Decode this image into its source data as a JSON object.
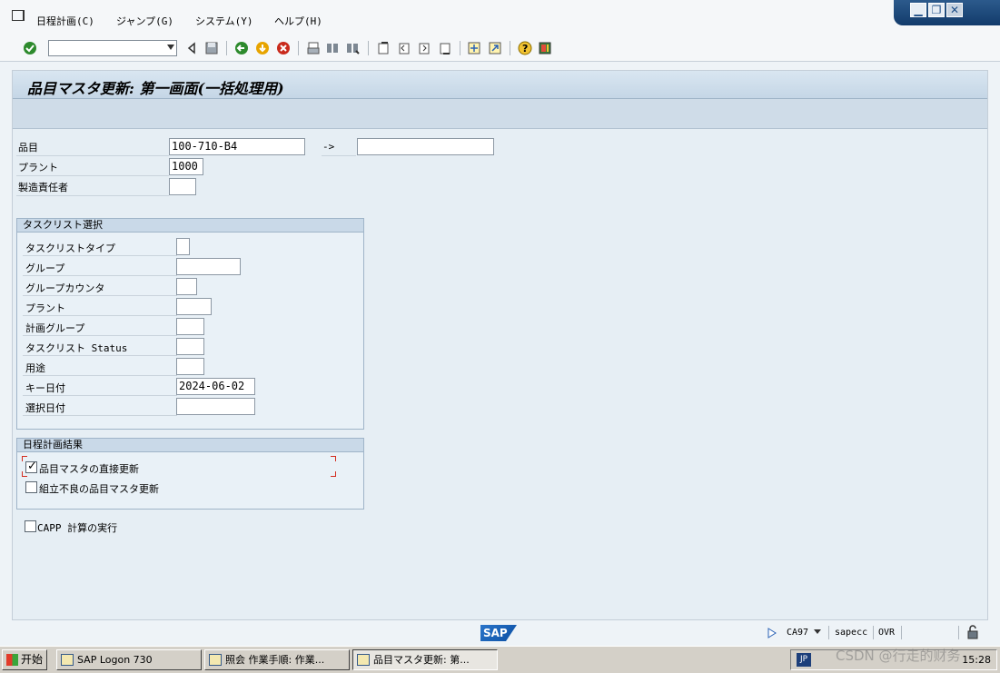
{
  "menubar": {
    "items": [
      "日程計画(C)",
      "ジャンプ(G)",
      "システム(Y)",
      "ヘルプ(H)"
    ]
  },
  "window_controls": {
    "minimize": "▁",
    "restore": "❐",
    "close": "✕"
  },
  "toolbar": {
    "command_field_value": "",
    "icons": [
      "enter-icon",
      "save-icon",
      "back-icon",
      "exit-icon",
      "cancel-icon",
      "print-icon",
      "find-icon",
      "find-next-icon",
      "first-page-icon",
      "previous-page-icon",
      "next-page-icon",
      "last-page-icon",
      "create-session-icon",
      "shortcut-icon",
      "help-icon",
      "layout-icon"
    ]
  },
  "page": {
    "title": "品目マスタ更新: 第一画面(一括処理用)"
  },
  "selection": {
    "material": {
      "label": "品目",
      "value": "100-710-B4",
      "to_arrow": "->",
      "to_value": ""
    },
    "plant": {
      "label": "プラント",
      "value": "1000"
    },
    "mrp_controller": {
      "label": "製造責任者",
      "value": ""
    }
  },
  "task_list_selection": {
    "header": "タスクリスト選択",
    "fields": [
      {
        "label": "タスクリストタイプ",
        "value": ""
      },
      {
        "label": "グループ",
        "value": ""
      },
      {
        "label": "グループカウンタ",
        "value": ""
      },
      {
        "label": "プラント",
        "value": ""
      },
      {
        "label": "計画グループ",
        "value": ""
      },
      {
        "label": "タスクリスト Status",
        "value": ""
      },
      {
        "label": "用途",
        "value": ""
      },
      {
        "label": "キー日付",
        "value": "2024-06-02"
      },
      {
        "label": "選択日付",
        "value": ""
      }
    ]
  },
  "scheduling_results": {
    "header": "日程計画結果",
    "options": [
      {
        "label": "品目マスタの直接更新",
        "checked": true
      },
      {
        "label": "組立不良の品目マスタ更新",
        "checked": false
      }
    ]
  },
  "capp": {
    "label": "CAPP 計算の実行",
    "checked": false
  },
  "statusbar": {
    "logo": "SAP",
    "system": "CA97",
    "server": "sapecc",
    "mode": "OVR"
  },
  "taskbar": {
    "start": "开始",
    "tasks": [
      "SAP Logon 730",
      "照会 作業手順: 作業...",
      "品目マスタ更新: 第..."
    ],
    "language": "JP",
    "clock": "15:28"
  },
  "watermark": "CSDN @行走的财务"
}
